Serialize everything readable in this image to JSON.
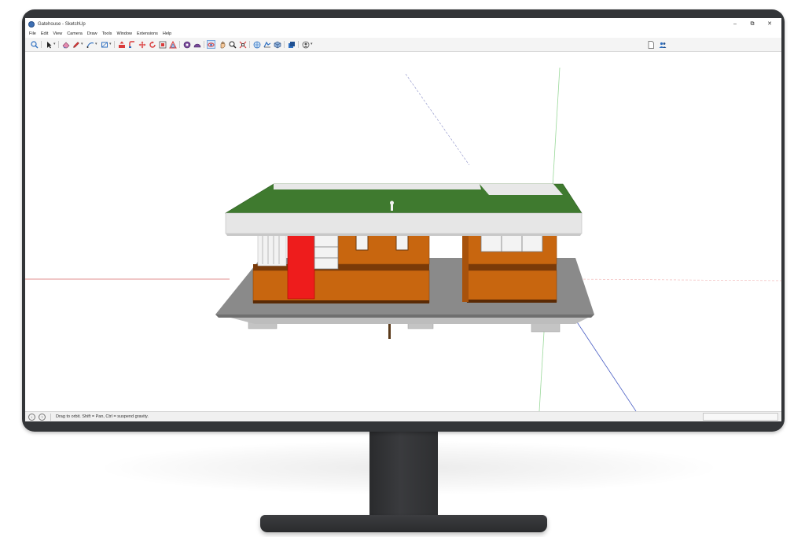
{
  "window": {
    "title": "Gatehouse - SketchUp",
    "controls": {
      "minimize": "–",
      "restore": "⧉",
      "close": "✕"
    }
  },
  "menu": [
    "File",
    "Edit",
    "View",
    "Camera",
    "Draw",
    "Tools",
    "Window",
    "Extensions",
    "Help"
  ],
  "toolbar": {
    "tools": [
      {
        "name": "search-icon"
      },
      {
        "name": "select-arrow-icon"
      },
      {
        "name": "eraser-icon"
      },
      {
        "name": "pencil-icon"
      },
      {
        "name": "line-icon"
      },
      {
        "name": "rectangle-icon"
      },
      {
        "name": "push-pull-icon"
      },
      {
        "name": "follow-me-icon"
      },
      {
        "name": "move-icon"
      },
      {
        "name": "rotate-icon"
      },
      {
        "name": "scale-icon"
      },
      {
        "name": "offset-icon"
      },
      {
        "name": "tape-measure-icon"
      },
      {
        "name": "protractor-icon"
      },
      {
        "name": "orbit-icon"
      },
      {
        "name": "pan-icon"
      },
      {
        "name": "zoom-icon"
      },
      {
        "name": "zoom-extents-icon"
      },
      {
        "name": "geo-location-icon"
      },
      {
        "name": "sandbox-icon"
      },
      {
        "name": "components-icon"
      },
      {
        "name": "materials-icon"
      },
      {
        "name": "account-icon"
      }
    ],
    "active_tool": "orbit-icon",
    "right_tools": [
      {
        "name": "document-icon"
      },
      {
        "name": "users-icon"
      }
    ]
  },
  "status": {
    "text": "Drag to orbit. Shift = Pan, Ctrl = suspend gravity.",
    "icons": [
      "info-icon",
      "help-icon"
    ]
  },
  "colors": {
    "roof": "#3f7a2f",
    "fascia": "#e6e6e6",
    "walls": "#c8660f",
    "door": "#ee1c1c",
    "deck": "#8a8a8a",
    "axis_red": "#d96a6a",
    "axis_green": "#7fd07f",
    "axis_blue": "#4a5fc4",
    "bezel": "#333538"
  }
}
